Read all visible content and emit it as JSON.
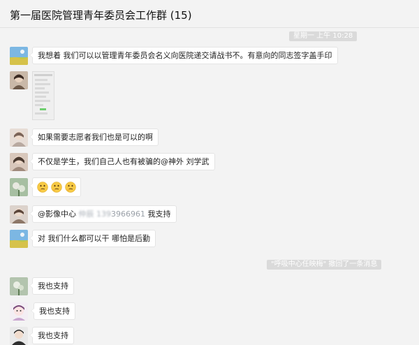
{
  "window": {
    "title": "第一届医院管理青年委员会工作群 (15)"
  },
  "timestamp": "星期一 上午 10:28",
  "recall_notice": "\"呼吸中心任映梅\" 撤回了一条消息",
  "messages": [
    {
      "text": "我想着 我们可以以管理青年委员会名义向医院递交请战书不。有意向的同志签字盖手印"
    },
    {
      "text": ""
    },
    {
      "text": "如果需要志愿者我们也是可以的啊"
    },
    {
      "text": "不仅是学生，我们自己人也有被骗的@神外 刘学武"
    },
    {
      "emojis": [
        "thinking-emoji",
        "thinking-emoji",
        "thinking-emoji"
      ]
    },
    {
      "mention": "@影像中心",
      "blurred": "仲辰 139",
      "phone_tail": "3966961",
      "suffix": "我支持"
    },
    {
      "text": "对 我们什么都可以干 哪怕是后勤"
    },
    {
      "text": "我也支持"
    },
    {
      "text": "我也支持"
    },
    {
      "text": "我也支持"
    }
  ],
  "colors": {
    "background": "#f3f3f3",
    "bubble": "#ffffff",
    "system_tag": "#dadada"
  }
}
